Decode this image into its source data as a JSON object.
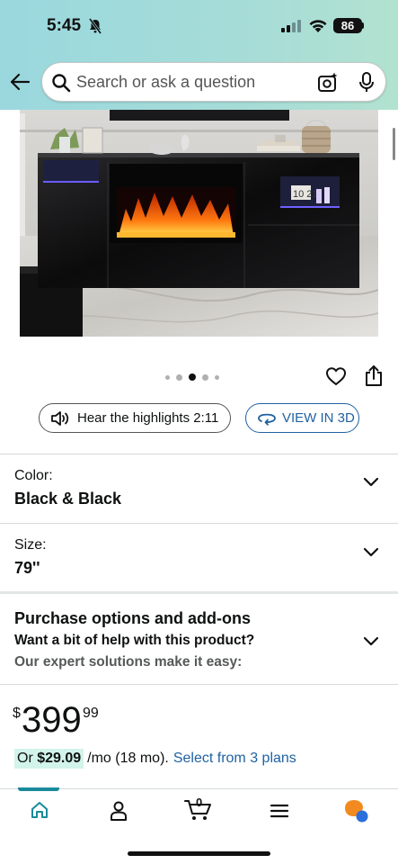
{
  "status_bar": {
    "time": "5:45",
    "battery": "86"
  },
  "header": {
    "search_placeholder": "Search or ask a question"
  },
  "product": {
    "image_label": "Black TV stand with electric fireplace and LED lights",
    "clock_display": "10 21",
    "carousel": {
      "total": 5,
      "active_index": 2
    }
  },
  "actions": {
    "hear_highlights": "Hear the highlights 2:11",
    "view_3d": "VIEW IN 3D"
  },
  "color": {
    "label": "Color:",
    "value": "Black & Black"
  },
  "size": {
    "label": "Size:",
    "value": "79''"
  },
  "purchase_options": {
    "title": "Purchase options and add-ons",
    "line1": "Want a bit of help with this product?",
    "line2": "Our expert solutions make it easy:"
  },
  "price": {
    "currency": "$",
    "whole": "399",
    "fraction": "99"
  },
  "installment": {
    "prefix": "Or ",
    "amount": "$29.09",
    "terms": "/mo (18 mo).",
    "link": "Select from 3 plans"
  },
  "colors": {
    "accent_link": "#2162a1",
    "teal_header": "#9ad8de",
    "installment_highlight": "#d2f4ea",
    "nav_active": "#1a8a9a"
  },
  "bottom_nav": {
    "cart_count": "0",
    "items": [
      "home-icon",
      "account-icon",
      "cart-icon",
      "menu-icon",
      "rufus-icon"
    ]
  }
}
